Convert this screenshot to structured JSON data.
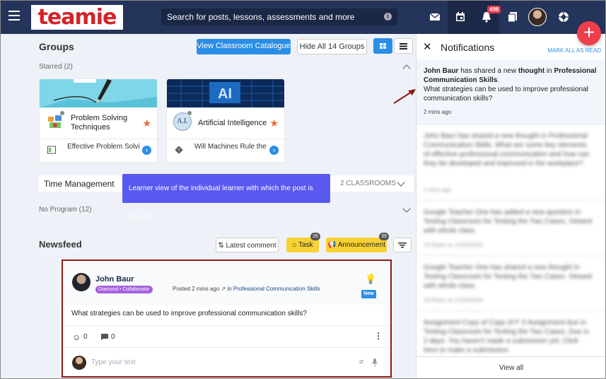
{
  "header": {
    "logo": "teamie",
    "search_placeholder": "Search for posts, lessons, assessments and more",
    "search_info": "i",
    "notification_count": "498"
  },
  "groups": {
    "heading": "Groups",
    "view_catalogue": "View Classroom Catalogue",
    "hide_all": "Hide All 14 Groups",
    "starred_label": "Starred (2)",
    "cards": [
      {
        "title": "Problem Solving Techniques",
        "sub": "Effective Problem Solvi",
        "icon_text": ""
      },
      {
        "title": "Artificial Intelligence",
        "sub": "Will Machines Rule the",
        "icon_text": "A.I."
      }
    ],
    "time_management": "Time Management",
    "classrooms_count": "2 CLASSROOMS",
    "no_program": "No Program (12)"
  },
  "tooltip": "Learner view of the individual learner with which the post is shared",
  "newsfeed": {
    "heading": "Newsfeed",
    "sort_label": "Latest comment",
    "task_label": "Task",
    "task_count": "26",
    "announcement_label": "Announcement",
    "announcement_count": "39"
  },
  "post": {
    "author": "John Baur",
    "badge": "Diamond • Collaborator",
    "posted": "Posted 2 mins ago",
    "in_label": "in",
    "group": "Professional Communication Skills",
    "new_label": "New",
    "question": "What strategies can be used to improve professional communication skills?",
    "reactions": "0",
    "comments": "0",
    "comment_placeholder": "Type your text"
  },
  "notifications": {
    "title": "Notifications",
    "mark_all": "MARK ALL AS READ",
    "first": {
      "author": "John Baur",
      "t1": " has shared a new ",
      "kind": "thought",
      "t2": " in ",
      "group": "Professional Communication Skills",
      "t3": ".",
      "text": "What strategies can be used to improve professional communication skills?",
      "time": "2 mins ago"
    },
    "blurred": [
      {
        "text": "John Baur has shared a new thought in Professional Communication Skills. What are some key elements of effective professional communication and how can they be developed and improved in the workplace?",
        "time": "2 mins ago"
      },
      {
        "text": "Google Teacher One has added a new question in Testing Classroom for Testing the Two Cases. Viewed with whole class.",
        "time": "10:32am on 11/03/2024"
      },
      {
        "text": "Google Teacher One has shared a new thought in Testing Classroom for Testing the Two Cases. Viewed with whole class.",
        "time": "10:32am on 11/03/2024"
      },
      {
        "text": "Assignment Copy of Copy of F S Assignment due in Testing Classroom for Testing the Two Cases. Due in 2 days. You haven't made a submission yet. Click here to make a submission.",
        "time": ""
      }
    ],
    "view_all": "View all"
  }
}
